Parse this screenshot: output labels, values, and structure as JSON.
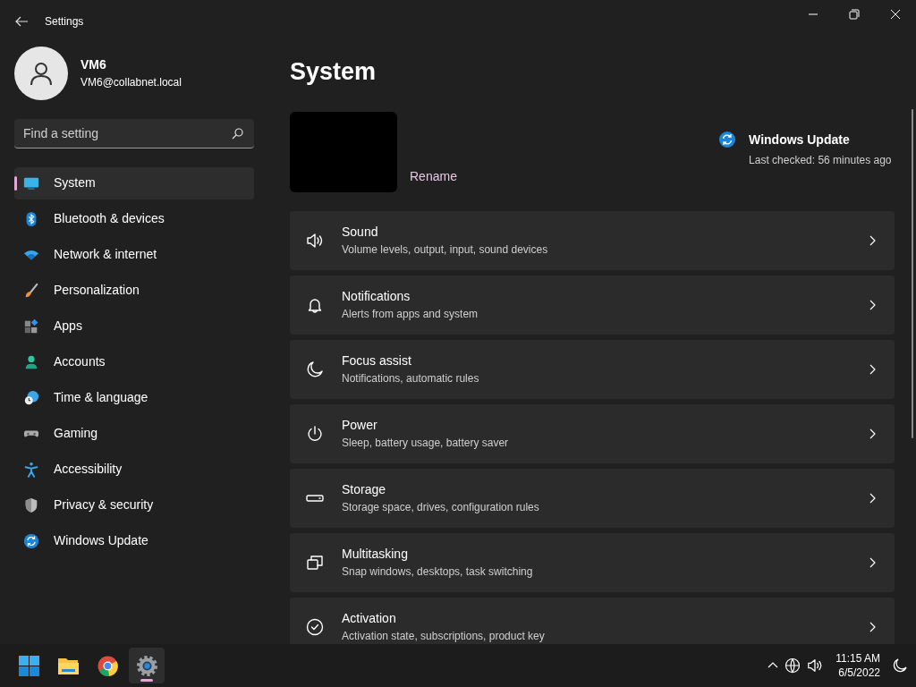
{
  "window": {
    "title": "Settings"
  },
  "user": {
    "name": "VM6",
    "email": "VM6@collabnet.local"
  },
  "search": {
    "placeholder": "Find a setting"
  },
  "nav": [
    {
      "kind": "system",
      "label": "System",
      "selected": true
    },
    {
      "kind": "bluetooth",
      "label": "Bluetooth & devices",
      "selected": false
    },
    {
      "kind": "network",
      "label": "Network & internet",
      "selected": false
    },
    {
      "kind": "brush",
      "label": "Personalization",
      "selected": false
    },
    {
      "kind": "apps",
      "label": "Apps",
      "selected": false
    },
    {
      "kind": "accounts",
      "label": "Accounts",
      "selected": false
    },
    {
      "kind": "time",
      "label": "Time & language",
      "selected": false
    },
    {
      "kind": "gaming",
      "label": "Gaming",
      "selected": false
    },
    {
      "kind": "accessibility",
      "label": "Accessibility",
      "selected": false
    },
    {
      "kind": "privacy",
      "label": "Privacy & security",
      "selected": false
    },
    {
      "kind": "update",
      "label": "Windows Update",
      "selected": false
    }
  ],
  "page": {
    "title": "System"
  },
  "device": {
    "rename": "Rename"
  },
  "update": {
    "title": "Windows Update",
    "status": "Last checked: 56 minutes ago"
  },
  "cards": [
    {
      "kind": "sound",
      "title": "Sound",
      "subtitle": "Volume levels, output, input, sound devices"
    },
    {
      "kind": "bell",
      "title": "Notifications",
      "subtitle": "Alerts from apps and system"
    },
    {
      "kind": "moon",
      "title": "Focus assist",
      "subtitle": "Notifications, automatic rules"
    },
    {
      "kind": "power",
      "title": "Power",
      "subtitle": "Sleep, battery usage, battery saver"
    },
    {
      "kind": "storage",
      "title": "Storage",
      "subtitle": "Storage space, drives, configuration rules"
    },
    {
      "kind": "multitask",
      "title": "Multitasking",
      "subtitle": "Snap windows, desktops, task switching"
    },
    {
      "kind": "check",
      "title": "Activation",
      "subtitle": "Activation state, subscriptions, product key"
    }
  ],
  "taskbar": {
    "apps": [
      {
        "kind": "start",
        "selected": false
      },
      {
        "kind": "folder",
        "selected": false
      },
      {
        "kind": "browser",
        "selected": false
      },
      {
        "kind": "settings",
        "selected": true
      }
    ],
    "time": "11:15 AM",
    "date": "6/5/2022"
  }
}
